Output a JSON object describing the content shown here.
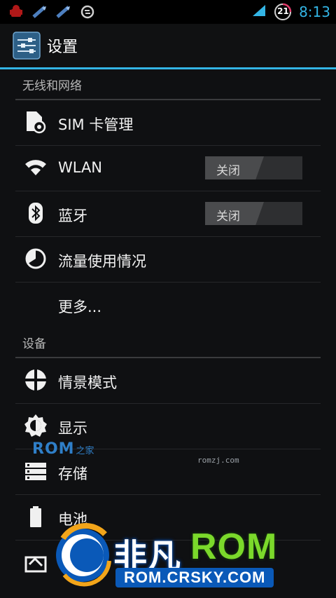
{
  "status_bar": {
    "time": "8:13",
    "notification_badge": "21",
    "icons": [
      "android-debug-icon",
      "usb-icon",
      "usb-icon",
      "sync-icon"
    ],
    "signal": "signal-icon"
  },
  "action_bar": {
    "title": "设置",
    "icon": "settings-sliders-icon"
  },
  "sections": [
    {
      "header": "无线和网络",
      "items": [
        {
          "label": "SIM 卡管理",
          "icon": "sim-card-icon"
        },
        {
          "label": "WLAN",
          "icon": "wifi-icon",
          "toggle": "关闭"
        },
        {
          "label": "蓝牙",
          "icon": "bluetooth-icon",
          "toggle": "关闭"
        },
        {
          "label": "流量使用情况",
          "icon": "data-usage-icon"
        },
        {
          "label": "更多...",
          "icon": ""
        }
      ]
    },
    {
      "header": "设备",
      "items": [
        {
          "label": "情景模式",
          "icon": "profiles-icon"
        },
        {
          "label": "显示",
          "icon": "display-brightness-icon"
        },
        {
          "label": "存储",
          "icon": "storage-icon"
        },
        {
          "label": "电池",
          "icon": "battery-icon"
        },
        {
          "label": "",
          "icon": "apps-icon"
        }
      ]
    }
  ],
  "watermarks": {
    "small_brand": "ROM",
    "small_brand_suffix": "之家",
    "small_url": "romzj.com",
    "big_brand_cn": "非凡",
    "big_brand": "ROM",
    "big_url": "ROM.CRSKY.COM"
  },
  "colors": {
    "accent": "#33b5e5",
    "background": "#0f1012"
  }
}
